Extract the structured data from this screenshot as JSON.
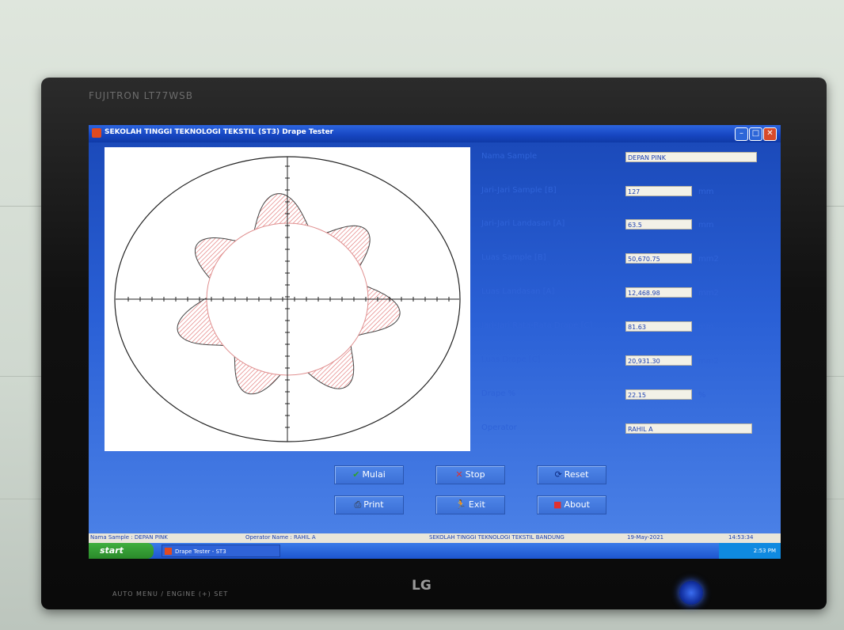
{
  "window": {
    "title": "SEKOLAH TINGGI TEKNOLOGI TEKSTIL (ST3) Drape Tester"
  },
  "monitor": {
    "brand": "FUJITRON LT77WSB",
    "bottom_controls": "AUTO   MENU / ENGINE   (+)   SET",
    "logo": "LG"
  },
  "form": {
    "fields": [
      {
        "label": "Nama Sample",
        "value": "DEPAN PINK",
        "unit": ""
      },
      {
        "label": "Jari-Jari Sample [B]",
        "value": "127",
        "unit": "mm"
      },
      {
        "label": "Jari-Jari Landasan [A]",
        "value": "63.5",
        "unit": "mm"
      },
      {
        "label": "Luas Sample [B]",
        "value": "50,670.75",
        "unit": "mm2"
      },
      {
        "label": "Luas Landasan [A]",
        "value": "12,468.98",
        "unit": "mm2"
      },
      {
        "label": "Jari-Jari Rata-Rata Drape [C]",
        "value": "81.63",
        "unit": "mm"
      },
      {
        "label": "Luas Drape [C]",
        "value": "20,931.30",
        "unit": "mm2"
      },
      {
        "label": "Drape %",
        "value": "22.15",
        "unit": "%"
      },
      {
        "label": "Operator",
        "value": "RAHIL A",
        "unit": ""
      }
    ]
  },
  "buttons": {
    "mulai": "Mulai",
    "stop": "Stop",
    "reset": "Reset",
    "print": "Print",
    "exit": "Exit",
    "about": "About"
  },
  "statusbar": {
    "sample": "Nama Sample : DEPAN PINK",
    "operator": "Operator Name : RAHIL A",
    "school": "SEKOLAH TINGGI TEKNOLOGI TEKSTIL BANDUNG",
    "date": "19-May-2021",
    "time": "14:53:34"
  },
  "taskbar": {
    "start": "start",
    "item": "Drape Tester - ST3",
    "clock": "2:53 PM"
  },
  "colors": {
    "drape_fill": "#e06a6a",
    "label": "#2f63d8"
  },
  "icons": [
    "check-icon",
    "stop-icon",
    "reset-icon",
    "printer-icon",
    "exit-icon",
    "about-icon"
  ]
}
